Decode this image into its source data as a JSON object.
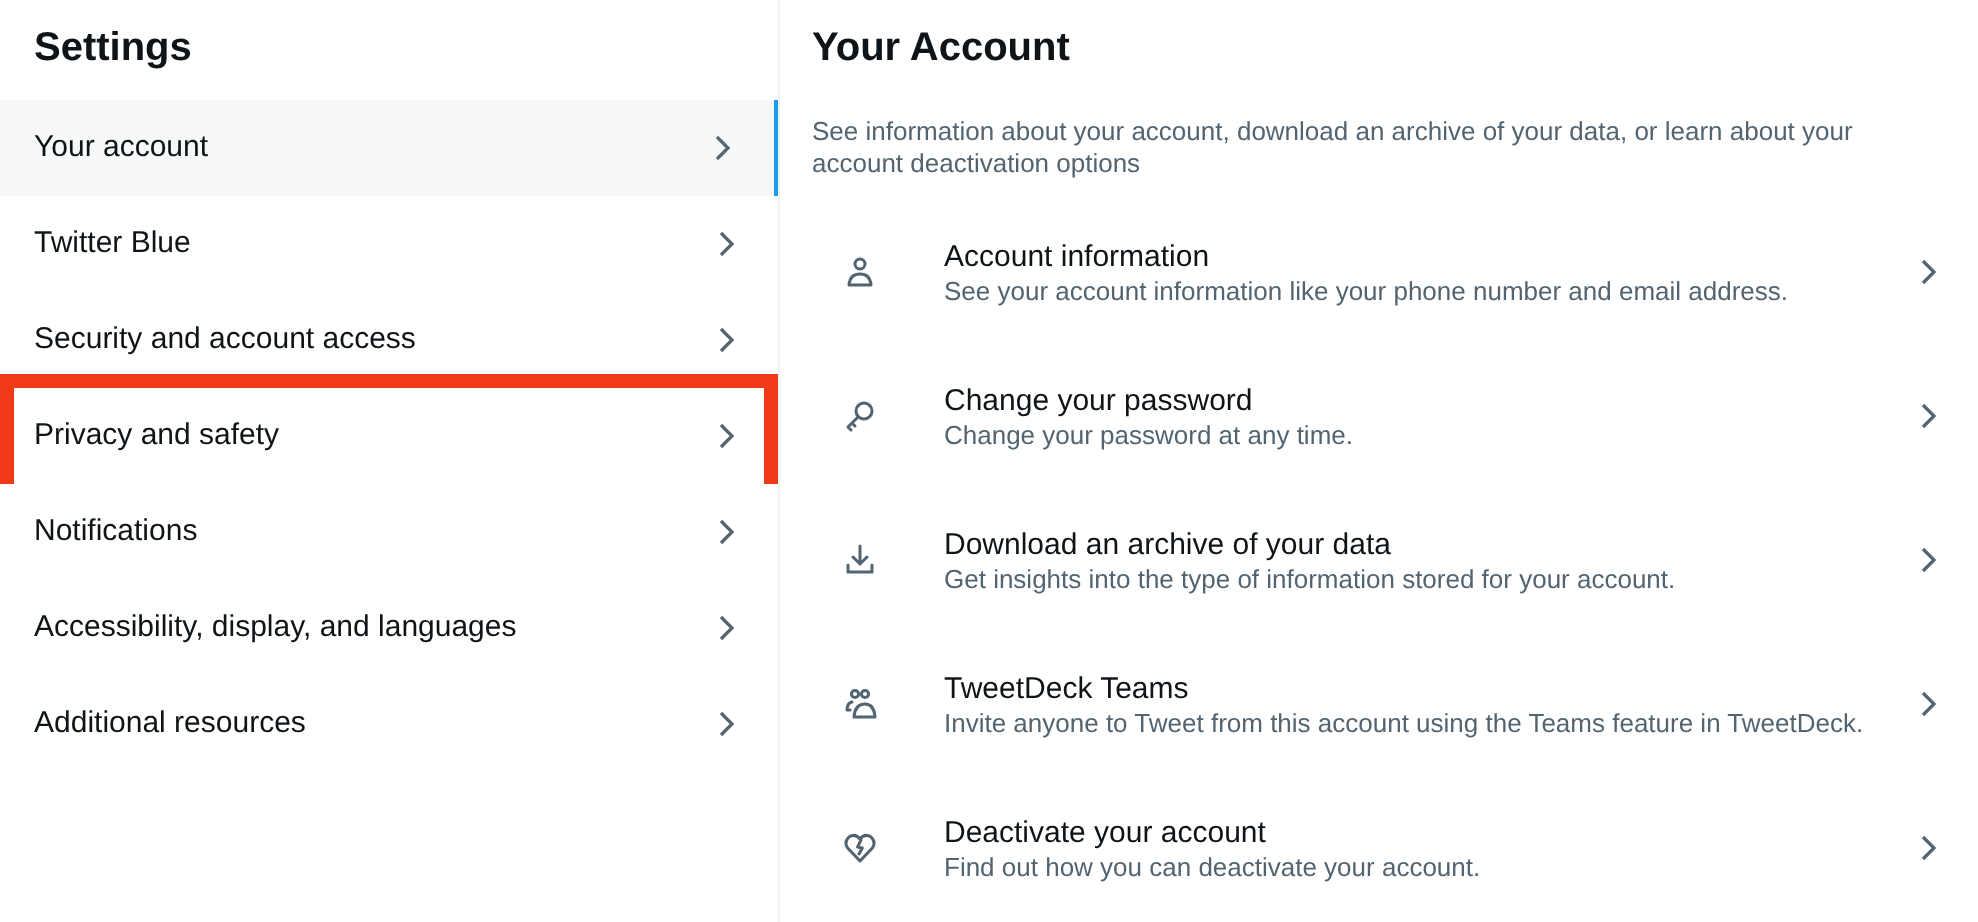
{
  "sidebar": {
    "title": "Settings",
    "items": [
      {
        "label": "Your account",
        "selected": true,
        "highlighted": false
      },
      {
        "label": "Twitter Blue",
        "selected": false,
        "highlighted": false
      },
      {
        "label": "Security and account access",
        "selected": false,
        "highlighted": false
      },
      {
        "label": "Privacy and safety",
        "selected": false,
        "highlighted": true
      },
      {
        "label": "Notifications",
        "selected": false,
        "highlighted": false
      },
      {
        "label": "Accessibility, display, and languages",
        "selected": false,
        "highlighted": false
      },
      {
        "label": "Additional resources",
        "selected": false,
        "highlighted": false
      }
    ]
  },
  "main": {
    "title": "Your Account",
    "description": "See information about your account, download an archive of your data, or learn about your account deactivation options",
    "items": [
      {
        "kind": "person",
        "title": "Account information",
        "subtitle": "See your account information like your phone number and email address."
      },
      {
        "kind": "key",
        "title": "Change your password",
        "subtitle": "Change your password at any time."
      },
      {
        "kind": "download",
        "title": "Download an archive of your data",
        "subtitle": "Get insights into the type of information stored for your account."
      },
      {
        "kind": "people",
        "title": "TweetDeck Teams",
        "subtitle": "Invite anyone to Tweet from this account using the Teams feature in TweetDeck."
      },
      {
        "kind": "heart",
        "title": "Deactivate your account",
        "subtitle": "Find out how you can deactivate your account."
      }
    ]
  }
}
